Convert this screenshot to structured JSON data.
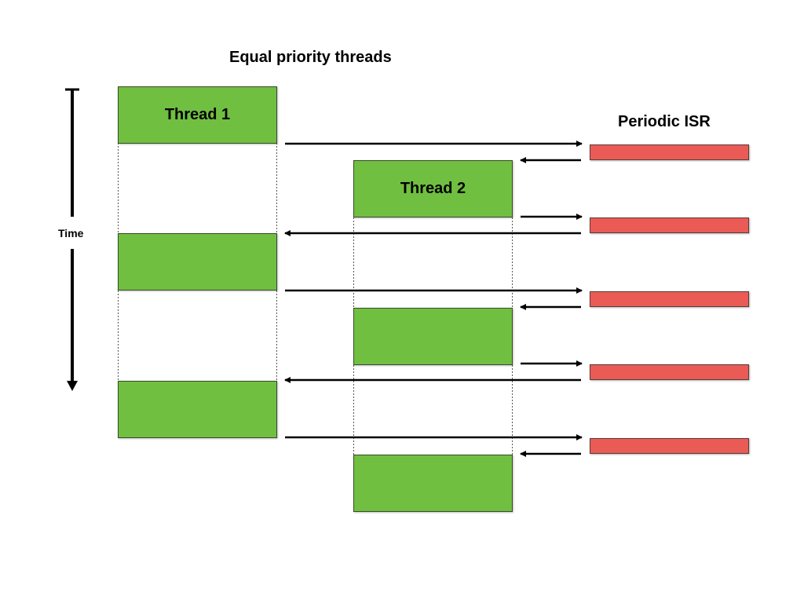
{
  "title": "Equal priority threads",
  "isr_title": "Periodic ISR",
  "time_axis": {
    "label": "Time",
    "direction": "down"
  },
  "colors": {
    "thread": "#70bf41",
    "isr": "#ea5b56",
    "arrow": "#000000"
  },
  "thread1": {
    "label": "Thread 1",
    "segments": [
      {
        "label": "Thread 1"
      },
      {
        "label": ""
      },
      {
        "label": ""
      }
    ]
  },
  "thread2": {
    "label": "Thread 2",
    "segments": [
      {
        "label": "Thread 2"
      },
      {
        "label": ""
      },
      {
        "label": ""
      }
    ]
  },
  "isr_events": [
    {
      "index": 1,
      "from": "Thread 1",
      "to": "Thread 2"
    },
    {
      "index": 2,
      "from": "Thread 2",
      "to": "Thread 1"
    },
    {
      "index": 3,
      "from": "Thread 1",
      "to": "Thread 2"
    },
    {
      "index": 4,
      "from": "Thread 2",
      "to": "Thread 1"
    },
    {
      "index": 5,
      "from": "Thread 1",
      "to": "Thread 2"
    }
  ]
}
